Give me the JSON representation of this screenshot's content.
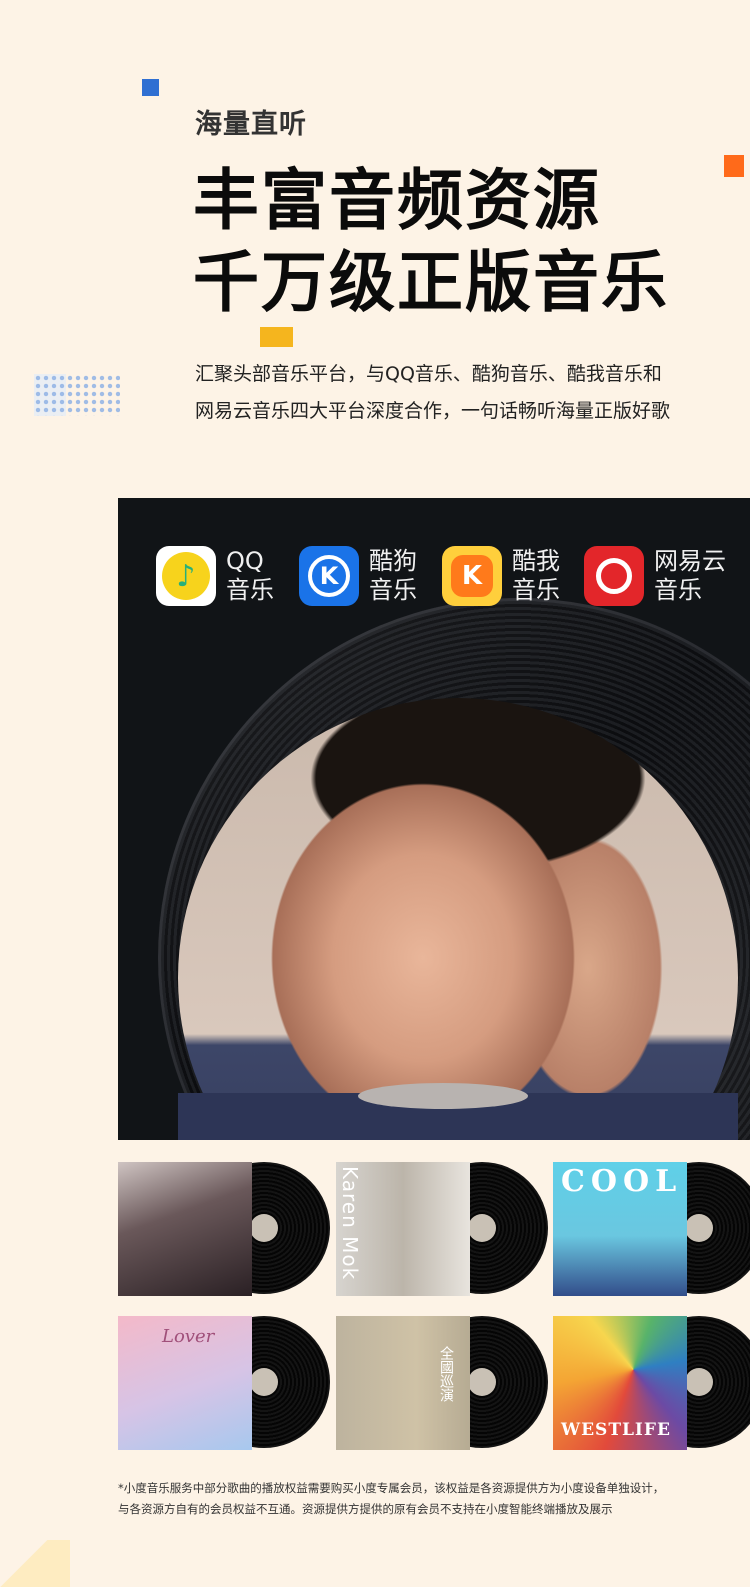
{
  "section": {
    "eyebrow": "海量直听",
    "headline_line1": "丰富音频资源",
    "headline_line2": "千万级正版音乐",
    "description_line1": "汇聚头部音乐平台，与QQ音乐、酷狗音乐、酷我音乐和",
    "description_line2": "网易云音乐四大平台深度合作，一句话畅听海量正版好歌"
  },
  "platforms": [
    {
      "name_line1": "QQ",
      "name_line2": "音乐",
      "icon": "qq-music-icon",
      "color": "#f7d31c"
    },
    {
      "name_line1": "酷狗",
      "name_line2": "音乐",
      "icon": "kugou-music-icon",
      "color": "#1a73e8"
    },
    {
      "name_line1": "酷我",
      "name_line2": "音乐",
      "icon": "kuwo-music-icon",
      "color": "#ffcf3c"
    },
    {
      "name_line1": "网易云",
      "name_line2": "音乐",
      "icon": "netease-music-icon",
      "color": "#e3262a"
    }
  ],
  "albums": {
    "a2_text": "Karen Mok",
    "a3_text": "COOL",
    "a4_text": "Lover",
    "a5_text": "全國巡演",
    "a6_text": "WESTLIFE"
  },
  "footnote": {
    "line1": "*小度音乐服务中部分歌曲的播放权益需要购买小度专属会员，该权益是各资源提供方为小度设备单独设计，",
    "line2": "与各资源方自有的会员权益不互通。资源提供方提供的原有会员不支持在小度智能终端播放及展示"
  },
  "colors": {
    "background": "#fdf3e6",
    "accent_blue": "#2f6fd2",
    "accent_orange": "#ff6a1a",
    "accent_yellow": "#f5b51e"
  }
}
